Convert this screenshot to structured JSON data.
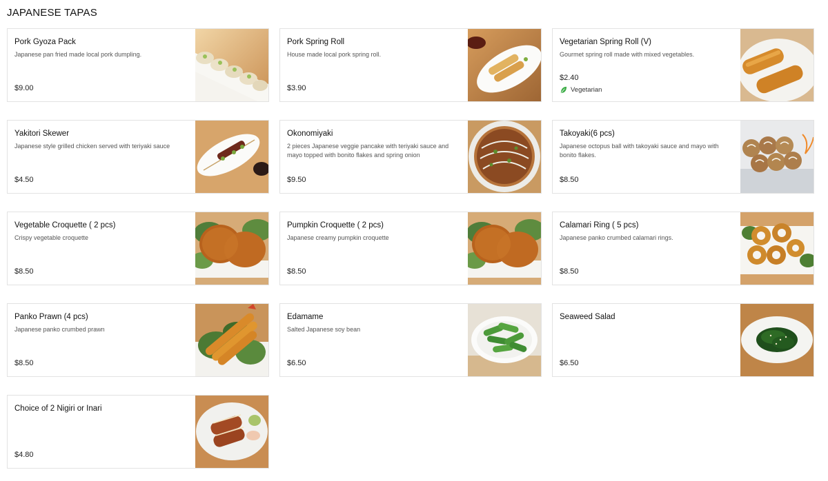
{
  "section": {
    "title": "JAPANESE TAPAS"
  },
  "items": [
    {
      "name": "Pork Gyoza Pack",
      "description": "Japanese pan fried made local pork dumpling.",
      "price": "$9.00",
      "tag": null,
      "photo": "gyoza-photo"
    },
    {
      "name": "Pork Spring Roll",
      "description": "House made local pork spring roll.",
      "price": "$3.90",
      "tag": null,
      "photo": "spring-roll-photo"
    },
    {
      "name": "Vegetarian Spring Roll (V)",
      "description": "Gourmet spring roll made with mixed vegetables.",
      "price": "$2.40",
      "tag": "Vegetarian",
      "photo": "veg-spring-roll-photo"
    },
    {
      "name": "Yakitori Skewer",
      "description": "Japanese style grilled chicken served with teriyaki sauce",
      "price": "$4.50",
      "tag": null,
      "photo": "yakitori-photo"
    },
    {
      "name": "Okonomiyaki",
      "description": "2 pieces Japanese veggie pancake with teriyaki sauce and mayo topped with bonito flakes and spring onion",
      "price": "$9.50",
      "tag": null,
      "photo": "okonomiyaki-photo"
    },
    {
      "name": "Takoyaki(6 pcs)",
      "description": "Japanese octopus ball with takoyaki sauce and mayo with bonito flakes.",
      "price": "$8.50",
      "tag": null,
      "photo": "takoyaki-photo"
    },
    {
      "name": "Vegetable Croquette ( 2 pcs)",
      "description": "Crispy vegetable croquette",
      "price": "$8.50",
      "tag": null,
      "photo": "croquette-photo"
    },
    {
      "name": "Pumpkin Croquette ( 2 pcs)",
      "description": "Japanese creamy pumpkin croquette",
      "price": "$8.50",
      "tag": null,
      "photo": "croquette-photo"
    },
    {
      "name": "Calamari Ring ( 5 pcs)",
      "description": "Japanese panko crumbed calamari rings.",
      "price": "$8.50",
      "tag": null,
      "photo": "calamari-photo"
    },
    {
      "name": "Panko Prawn (4 pcs)",
      "description": "Japanese panko crumbed prawn",
      "price": "$8.50",
      "tag": null,
      "photo": "prawn-photo"
    },
    {
      "name": "Edamame",
      "description": "Salted Japanese soy bean",
      "price": "$6.50",
      "tag": null,
      "photo": "edamame-photo"
    },
    {
      "name": "Seaweed Salad",
      "description": "",
      "price": "$6.50",
      "tag": null,
      "photo": "seaweed-salad-photo"
    },
    {
      "name": "Choice of 2 Nigiri or Inari",
      "description": "",
      "price": "$4.80",
      "tag": null,
      "photo": "nigiri-photo"
    }
  ],
  "colors": {
    "border": "#e2e2e2",
    "leaf": "#3fae49",
    "wood": "#d9a468"
  }
}
